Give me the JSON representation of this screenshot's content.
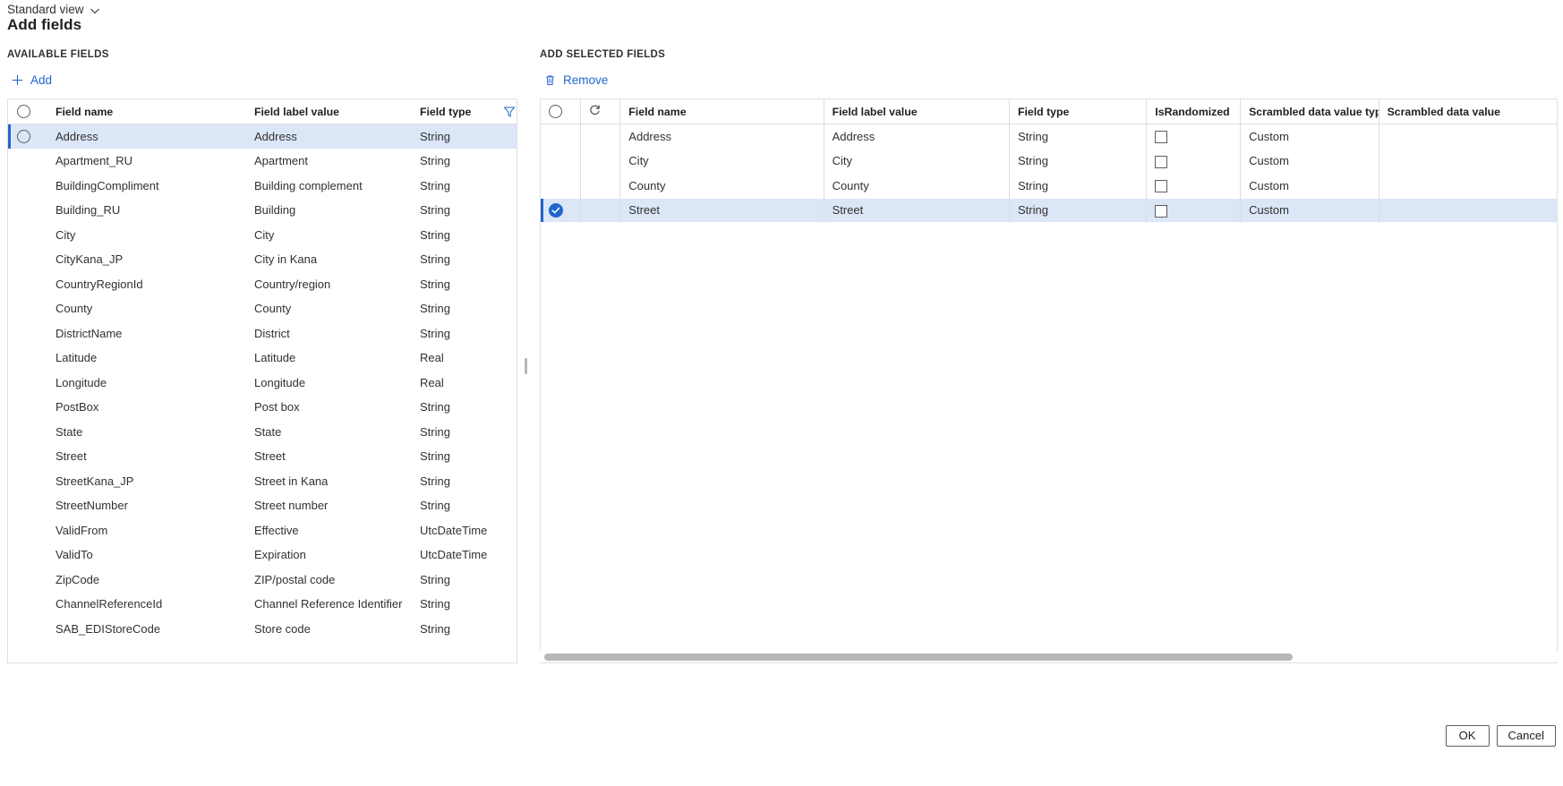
{
  "view_switcher": {
    "label": "Standard view",
    "chevron_icon": "chevron-down-icon"
  },
  "page_title": "Add fields",
  "panels": {
    "available": {
      "section_label": "AVAILABLE FIELDS",
      "command": {
        "label": "Add",
        "icon": "plus-icon"
      },
      "header_tools": {
        "filter_icon": "filter-funnel-icon",
        "overflow_icon": "more-vertical-icon"
      },
      "columns": [
        "Field name",
        "Field label value",
        "Field type"
      ],
      "rows": [
        {
          "field_name": "Address",
          "field_label_value": "Address",
          "field_type": "String",
          "selected": true
        },
        {
          "field_name": "Apartment_RU",
          "field_label_value": "Apartment",
          "field_type": "String",
          "selected": false
        },
        {
          "field_name": "BuildingCompliment",
          "field_label_value": "Building complement",
          "field_type": "String",
          "selected": false
        },
        {
          "field_name": "Building_RU",
          "field_label_value": "Building",
          "field_type": "String",
          "selected": false
        },
        {
          "field_name": "City",
          "field_label_value": "City",
          "field_type": "String",
          "selected": false
        },
        {
          "field_name": "CityKana_JP",
          "field_label_value": "City in Kana",
          "field_type": "String",
          "selected": false
        },
        {
          "field_name": "CountryRegionId",
          "field_label_value": "Country/region",
          "field_type": "String",
          "selected": false
        },
        {
          "field_name": "County",
          "field_label_value": "County",
          "field_type": "String",
          "selected": false
        },
        {
          "field_name": "DistrictName",
          "field_label_value": "District",
          "field_type": "String",
          "selected": false
        },
        {
          "field_name": "Latitude",
          "field_label_value": "Latitude",
          "field_type": "Real",
          "selected": false
        },
        {
          "field_name": "Longitude",
          "field_label_value": "Longitude",
          "field_type": "Real",
          "selected": false
        },
        {
          "field_name": "PostBox",
          "field_label_value": "Post box",
          "field_type": "String",
          "selected": false
        },
        {
          "field_name": "State",
          "field_label_value": "State",
          "field_type": "String",
          "selected": false
        },
        {
          "field_name": "Street",
          "field_label_value": "Street",
          "field_type": "String",
          "selected": false
        },
        {
          "field_name": "StreetKana_JP",
          "field_label_value": "Street in Kana",
          "field_type": "String",
          "selected": false
        },
        {
          "field_name": "StreetNumber",
          "field_label_value": "Street number",
          "field_type": "String",
          "selected": false
        },
        {
          "field_name": "ValidFrom",
          "field_label_value": "Effective",
          "field_type": "UtcDateTime",
          "selected": false
        },
        {
          "field_name": "ValidTo",
          "field_label_value": "Expiration",
          "field_type": "UtcDateTime",
          "selected": false
        },
        {
          "field_name": "ZipCode",
          "field_label_value": "ZIP/postal code",
          "field_type": "String",
          "selected": false
        },
        {
          "field_name": "ChannelReferenceId",
          "field_label_value": "Channel Reference Identifier",
          "field_type": "String",
          "selected": false
        },
        {
          "field_name": "SAB_EDIStoreCode",
          "field_label_value": "Store code",
          "field_type": "String",
          "selected": false
        }
      ]
    },
    "selected": {
      "section_label": "ADD SELECTED FIELDS",
      "command": {
        "label": "Remove",
        "icon": "trash-icon"
      },
      "header_tools": {
        "sync_icon": "refresh-icon",
        "overflow_icon": "more-vertical-icon"
      },
      "columns": [
        "Field name",
        "Field label value",
        "Field type",
        "IsRandomized",
        "Scrambled data value type",
        "Scrambled data value"
      ],
      "rows": [
        {
          "field_name": "Address",
          "field_label_value": "Address",
          "field_type": "String",
          "is_randomized": false,
          "scrambled_data_value_type": "Custom",
          "scrambled_data_value": "",
          "selected": false
        },
        {
          "field_name": "City",
          "field_label_value": "City",
          "field_type": "String",
          "is_randomized": false,
          "scrambled_data_value_type": "Custom",
          "scrambled_data_value": "",
          "selected": false
        },
        {
          "field_name": "County",
          "field_label_value": "County",
          "field_type": "String",
          "is_randomized": false,
          "scrambled_data_value_type": "Custom",
          "scrambled_data_value": "",
          "selected": false
        },
        {
          "field_name": "Street",
          "field_label_value": "Street",
          "field_type": "String",
          "is_randomized": false,
          "scrambled_data_value_type": "Custom",
          "scrambled_data_value": "",
          "selected": true
        }
      ]
    }
  },
  "footer": {
    "ok_label": "OK",
    "cancel_label": "Cancel"
  },
  "colors": {
    "accent": "#2266cc",
    "row_selected_bg": "#dbe6f7",
    "grid_border": "#e1dfdd",
    "ghost_text": "#a19f9d",
    "scrollbar_thumb": "#b6b6b6"
  }
}
